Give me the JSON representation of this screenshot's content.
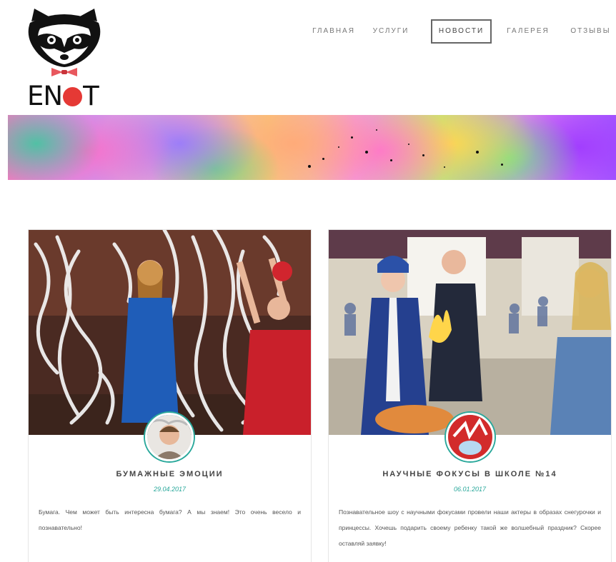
{
  "brand": {
    "logo_text_left": "EN",
    "logo_text_right": "T",
    "colors": {
      "accent": "#2aa89b",
      "logo_dot": "#e53935",
      "nav_text": "#777777"
    }
  },
  "nav": {
    "items": [
      {
        "label": "ГЛАВНАЯ",
        "active": false
      },
      {
        "label": "УСЛУГИ",
        "active": false
      },
      {
        "label": "НОВОСТИ",
        "active": true
      },
      {
        "label": "ГАЛЕРЕЯ",
        "active": false
      },
      {
        "label": "ОТЗЫВЫ",
        "active": false
      }
    ]
  },
  "news": [
    {
      "title": "БУМАЖНЫЕ ЭМОЦИИ",
      "date": "29.04.2017",
      "text": "Бумага. Чем может быть интересна бумага? А мы знаем! Это очень весело и познавательно!"
    },
    {
      "title": "НАУЧНЫЕ ФОКУСЫ В ШКОЛЕ №14",
      "date": "06.01.2017",
      "text": "Познавательное шоу с научными фокусами провели наши актеры в образах снегурочки и принцессы. Хочешь подарить своему ребенку такой же волшебный праздник? Скорее оставляй заявку!"
    }
  ],
  "icons": [
    "raccoon-logo-icon",
    "bow-tie-icon"
  ]
}
